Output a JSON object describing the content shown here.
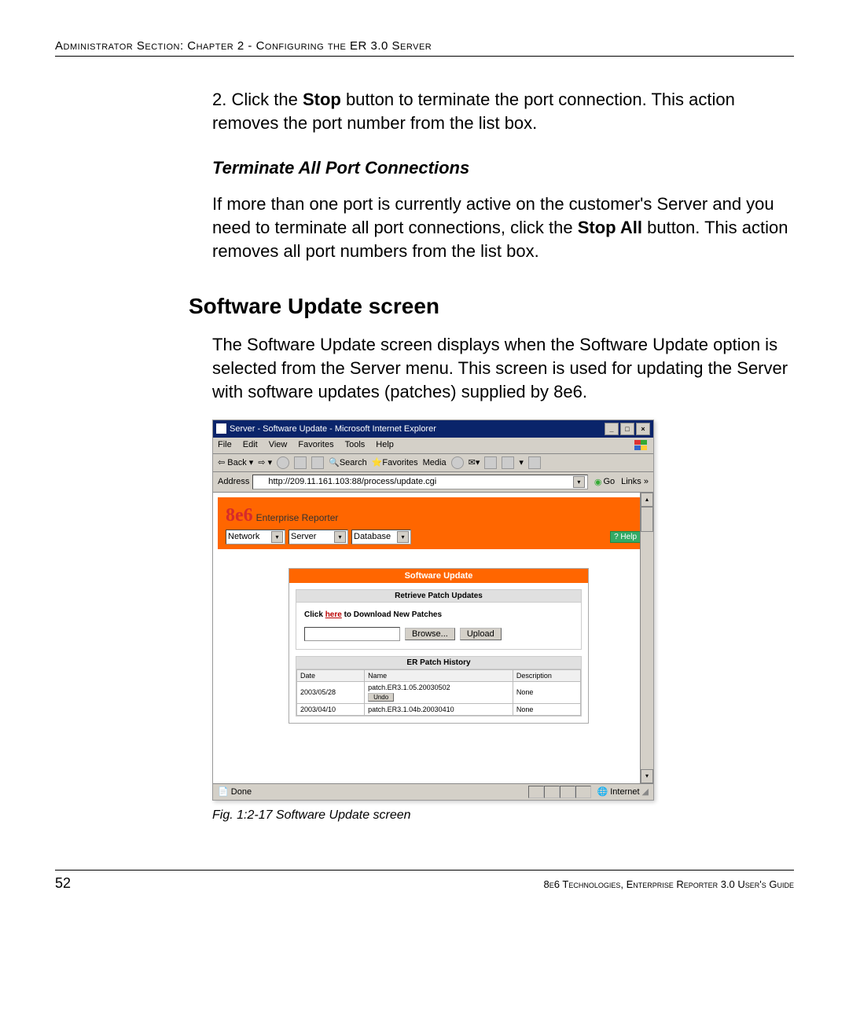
{
  "header": "Administrator Section: Chapter 2 - Configuring the ER 3.0 Server",
  "step2_prefix": "2.  Click the ",
  "step2_bold": "Stop",
  "step2_suffix": " button to terminate the port connection. This action removes the port number from the list box.",
  "subheading1": "Terminate All Port Connections",
  "para1_prefix": "If more than one port is currently active on the customer's Server and you need to terminate all port connections, click the ",
  "para1_bold": "Stop All",
  "para1_suffix": " button. This action removes all port numbers from the list box.",
  "heading2": "Software Update screen",
  "para2": "The Software Update screen displays when the Software Update option is selected from the Server menu. This screen is used for updating the Server with software updates (patches) supplied by 8e6.",
  "ie": {
    "title": "Server - Software Update - Microsoft Internet Explorer",
    "menus": [
      "File",
      "Edit",
      "View",
      "Favorites",
      "Tools",
      "Help"
    ],
    "back": "Back",
    "search": "Search",
    "favorites": "Favorites",
    "media": "Media",
    "address_label": "Address",
    "url": "http://209.11.161.103:88/process/update.cgi",
    "go": "Go",
    "links": "Links",
    "status_done": "Done",
    "status_zone": "Internet"
  },
  "app": {
    "brand": "8e6",
    "brand_sub": "Enterprise Reporter",
    "nav": [
      "Network",
      "Server",
      "Database"
    ],
    "help": "? Help",
    "panel_title": "Software Update",
    "retrieve_hdr": "Retrieve Patch Updates",
    "dl_pre": "Click ",
    "dl_link": "here",
    "dl_post": " to Download New Patches",
    "browse": "Browse...",
    "upload": "Upload",
    "history_hdr": "ER Patch History",
    "cols": {
      "date": "Date",
      "name": "Name",
      "desc": "Description"
    },
    "rows": [
      {
        "date": "2003/05/28",
        "name": "patch.ER3.1.05.20030502",
        "desc": "None",
        "undo": "Undo"
      },
      {
        "date": "2003/04/10",
        "name": "patch.ER3.1.04b.20030410",
        "desc": "None"
      }
    ]
  },
  "caption": "Fig. 1:2-17  Software Update screen",
  "footer": {
    "page": "52",
    "right": "8e6 Technologies, Enterprise Reporter 3.0 User's Guide"
  }
}
